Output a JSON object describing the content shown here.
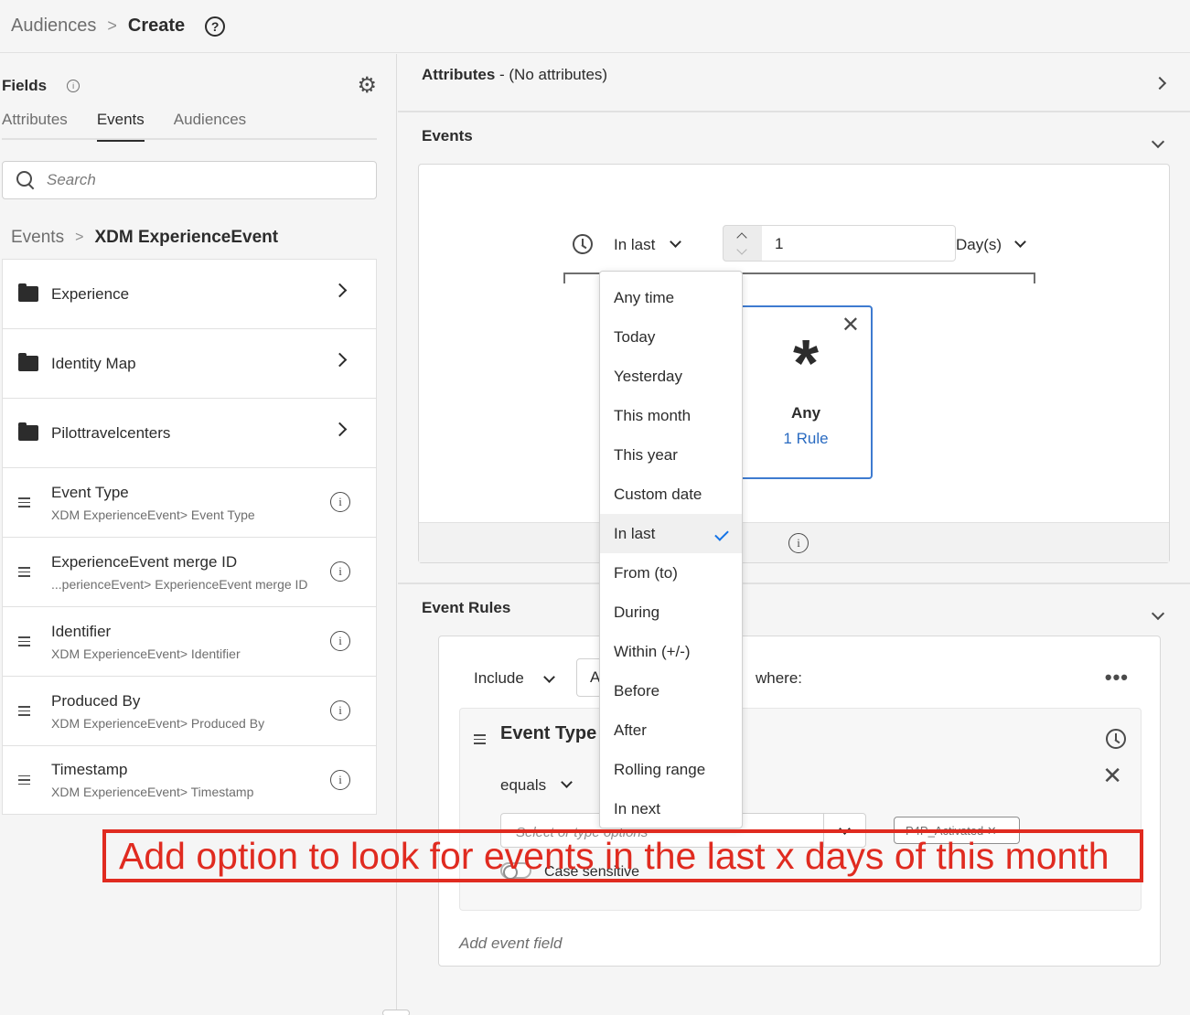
{
  "breadcrumb": {
    "root": "Audiences",
    "separator": ">",
    "current": "Create"
  },
  "fields_panel": {
    "title": "Fields",
    "tabs": [
      {
        "label": "Attributes",
        "active": false
      },
      {
        "label": "Events",
        "active": true
      },
      {
        "label": "Audiences",
        "active": false
      }
    ],
    "search_placeholder": "Search",
    "path": {
      "root": "Events",
      "separator": ">",
      "current": "XDM ExperienceEvent"
    },
    "folders": [
      {
        "label": "Experience",
        "icon": "folder-icon"
      },
      {
        "label": "Identity Map",
        "icon": "folder-icon"
      },
      {
        "label": "Pilottravelcenters",
        "icon": "folder-icon"
      }
    ],
    "fields": [
      {
        "name": "Event Type",
        "path": "XDM ExperienceEvent> Event Type"
      },
      {
        "name": "ExperienceEvent merge ID",
        "path": "...perienceEvent> ExperienceEvent merge ID"
      },
      {
        "name": "Identifier",
        "path": "XDM ExperienceEvent> Identifier"
      },
      {
        "name": "Produced By",
        "path": "XDM ExperienceEvent> Produced By"
      },
      {
        "name": "Timestamp",
        "path": "XDM ExperienceEvent> Timestamp"
      }
    ]
  },
  "attributes_section": {
    "title": "Attributes",
    "subtitle": " - (No attributes)"
  },
  "events_section": {
    "title": "Events",
    "time_selector": "In last",
    "count_value": "1",
    "unit_selector": "Day(s)",
    "any_card": {
      "symbol": "*",
      "label": "Any",
      "rule_count": "1 Rule"
    }
  },
  "time_dropdown": {
    "options": [
      "Any time",
      "Today",
      "Yesterday",
      "This month",
      "This year",
      "Custom date",
      "In last",
      "From (to)",
      "During",
      "Within (+/-)",
      "Before",
      "After",
      "Rolling range",
      "In next"
    ],
    "selected": "In last"
  },
  "event_rules": {
    "title": "Event Rules",
    "include_label": "Include",
    "any_box_partial": "A",
    "where_label": "where:",
    "more_label": "•••",
    "event_type": {
      "title": "Event Type",
      "operator": "equals",
      "options_placeholder": "Select or type options",
      "tag": "P4P_Activated",
      "case_sensitive_label": "Case sensitive"
    },
    "add_event_field": "Add event field"
  },
  "annotation": {
    "text": "Add option to look for events in the last x days of this month",
    "color": "#e02b20"
  },
  "colors": {
    "accent_blue": "#1473e6",
    "link_blue": "#2a6bc1",
    "selected_border": "#3e7bd0"
  }
}
